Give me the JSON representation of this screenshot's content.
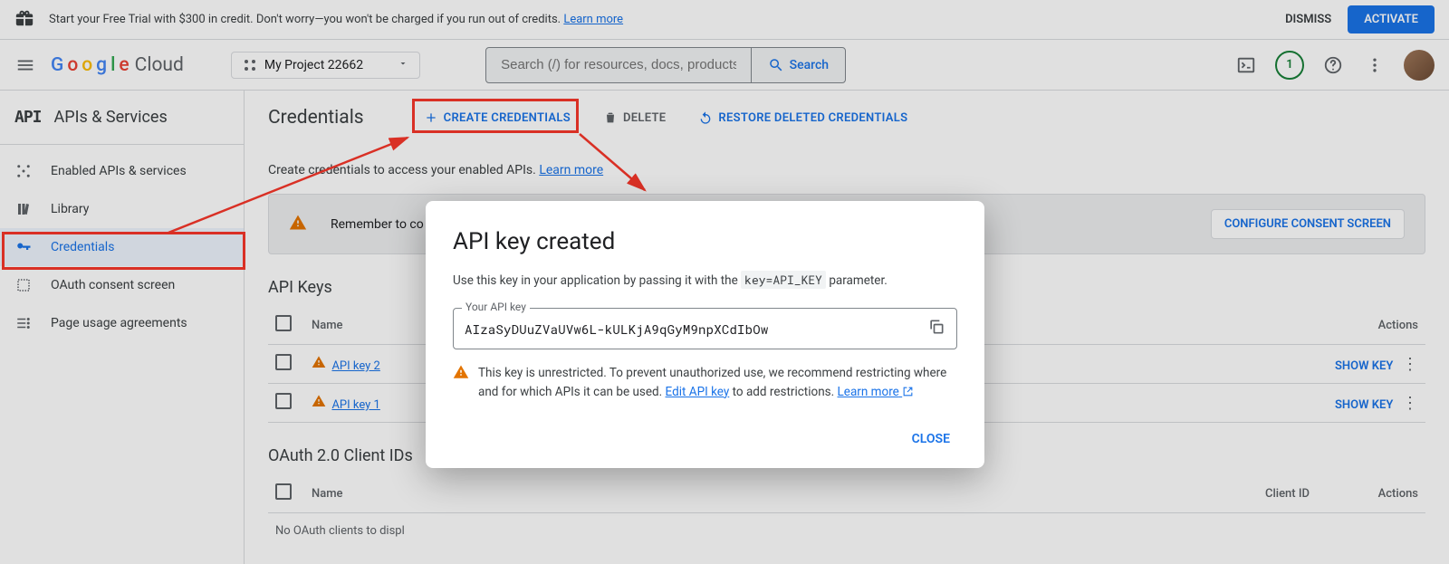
{
  "trial": {
    "text_prefix": "Start your Free Trial with $300 in credit. Don't worry—you won't be charged if you run out of credits. ",
    "learn_more": "Learn more",
    "dismiss": "DISMISS",
    "activate": "ACTIVATE"
  },
  "header": {
    "logo_cloud": "Cloud",
    "project_label": "My Project 22662",
    "search_placeholder": "Search (/) for resources, docs, products, and more",
    "search_button": "Search",
    "notif_count": "1"
  },
  "sidebar": {
    "title": "APIs & Services",
    "items": [
      {
        "label": "Enabled APIs & services"
      },
      {
        "label": "Library"
      },
      {
        "label": "Credentials"
      },
      {
        "label": "OAuth consent screen"
      },
      {
        "label": "Page usage agreements"
      }
    ]
  },
  "main": {
    "title": "Credentials",
    "create": "CREATE CREDENTIALS",
    "delete": "DELETE",
    "restore": "RESTORE DELETED CREDENTIALS",
    "subtitle_prefix": "Create credentials to access your enabled APIs. ",
    "subtitle_link": "Learn more",
    "consent_text": "Remember to co",
    "consent_button": "CONFIGURE CONSENT SCREEN",
    "api_keys_heading": "API Keys",
    "oauth_heading": "OAuth 2.0 Client IDs",
    "col_name": "Name",
    "col_actions": "Actions",
    "col_client_id": "Client ID",
    "keys": [
      {
        "name": "API key 2",
        "show": "SHOW KEY"
      },
      {
        "name": "API key 1",
        "show": "SHOW KEY"
      }
    ],
    "no_oauth": "No OAuth clients to displ"
  },
  "modal": {
    "title": "API key created",
    "desc_prefix": "Use this key in your application by passing it with the ",
    "desc_code": "key=API_KEY",
    "desc_suffix": " parameter.",
    "field_label": "Your API key",
    "api_key": "AIzaSyDUuZVaUVw6L-kULKjA9qGyM9npXCdIbOw",
    "warn_text1": "This key is unrestricted. To prevent unauthorized use, we recommend restricting where and for which APIs it can be used. ",
    "warn_link1": "Edit API key",
    "warn_text2": " to add restrictions. ",
    "warn_link2": "Learn more",
    "close": "CLOSE"
  }
}
